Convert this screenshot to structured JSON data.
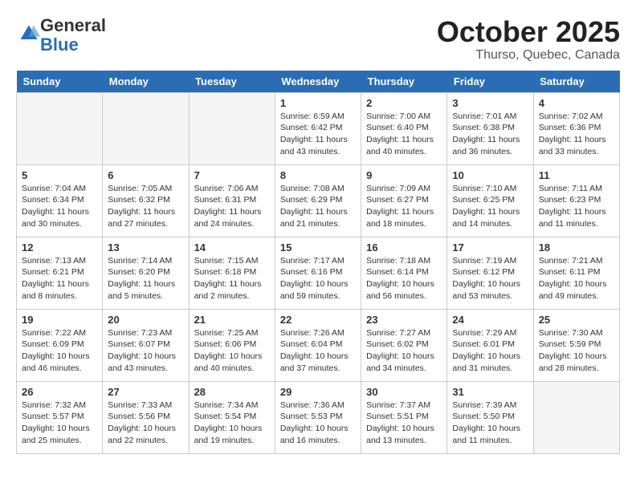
{
  "header": {
    "logo_general": "General",
    "logo_blue": "Blue",
    "month_year": "October 2025",
    "location": "Thurso, Quebec, Canada"
  },
  "days_of_week": [
    "Sunday",
    "Monday",
    "Tuesday",
    "Wednesday",
    "Thursday",
    "Friday",
    "Saturday"
  ],
  "weeks": [
    [
      {
        "day": "",
        "empty": true
      },
      {
        "day": "",
        "empty": true
      },
      {
        "day": "",
        "empty": true
      },
      {
        "day": "1",
        "sunrise": "6:59 AM",
        "sunset": "6:42 PM",
        "daylight": "11 hours and 43 minutes."
      },
      {
        "day": "2",
        "sunrise": "7:00 AM",
        "sunset": "6:40 PM",
        "daylight": "11 hours and 40 minutes."
      },
      {
        "day": "3",
        "sunrise": "7:01 AM",
        "sunset": "6:38 PM",
        "daylight": "11 hours and 36 minutes."
      },
      {
        "day": "4",
        "sunrise": "7:02 AM",
        "sunset": "6:36 PM",
        "daylight": "11 hours and 33 minutes."
      }
    ],
    [
      {
        "day": "5",
        "sunrise": "7:04 AM",
        "sunset": "6:34 PM",
        "daylight": "11 hours and 30 minutes."
      },
      {
        "day": "6",
        "sunrise": "7:05 AM",
        "sunset": "6:32 PM",
        "daylight": "11 hours and 27 minutes."
      },
      {
        "day": "7",
        "sunrise": "7:06 AM",
        "sunset": "6:31 PM",
        "daylight": "11 hours and 24 minutes."
      },
      {
        "day": "8",
        "sunrise": "7:08 AM",
        "sunset": "6:29 PM",
        "daylight": "11 hours and 21 minutes."
      },
      {
        "day": "9",
        "sunrise": "7:09 AM",
        "sunset": "6:27 PM",
        "daylight": "11 hours and 18 minutes."
      },
      {
        "day": "10",
        "sunrise": "7:10 AM",
        "sunset": "6:25 PM",
        "daylight": "11 hours and 14 minutes."
      },
      {
        "day": "11",
        "sunrise": "7:11 AM",
        "sunset": "6:23 PM",
        "daylight": "11 hours and 11 minutes."
      }
    ],
    [
      {
        "day": "12",
        "sunrise": "7:13 AM",
        "sunset": "6:21 PM",
        "daylight": "11 hours and 8 minutes."
      },
      {
        "day": "13",
        "sunrise": "7:14 AM",
        "sunset": "6:20 PM",
        "daylight": "11 hours and 5 minutes."
      },
      {
        "day": "14",
        "sunrise": "7:15 AM",
        "sunset": "6:18 PM",
        "daylight": "11 hours and 2 minutes."
      },
      {
        "day": "15",
        "sunrise": "7:17 AM",
        "sunset": "6:16 PM",
        "daylight": "10 hours and 59 minutes."
      },
      {
        "day": "16",
        "sunrise": "7:18 AM",
        "sunset": "6:14 PM",
        "daylight": "10 hours and 56 minutes."
      },
      {
        "day": "17",
        "sunrise": "7:19 AM",
        "sunset": "6:12 PM",
        "daylight": "10 hours and 53 minutes."
      },
      {
        "day": "18",
        "sunrise": "7:21 AM",
        "sunset": "6:11 PM",
        "daylight": "10 hours and 49 minutes."
      }
    ],
    [
      {
        "day": "19",
        "sunrise": "7:22 AM",
        "sunset": "6:09 PM",
        "daylight": "10 hours and 46 minutes."
      },
      {
        "day": "20",
        "sunrise": "7:23 AM",
        "sunset": "6:07 PM",
        "daylight": "10 hours and 43 minutes."
      },
      {
        "day": "21",
        "sunrise": "7:25 AM",
        "sunset": "6:06 PM",
        "daylight": "10 hours and 40 minutes."
      },
      {
        "day": "22",
        "sunrise": "7:26 AM",
        "sunset": "6:04 PM",
        "daylight": "10 hours and 37 minutes."
      },
      {
        "day": "23",
        "sunrise": "7:27 AM",
        "sunset": "6:02 PM",
        "daylight": "10 hours and 34 minutes."
      },
      {
        "day": "24",
        "sunrise": "7:29 AM",
        "sunset": "6:01 PM",
        "daylight": "10 hours and 31 minutes."
      },
      {
        "day": "25",
        "sunrise": "7:30 AM",
        "sunset": "5:59 PM",
        "daylight": "10 hours and 28 minutes."
      }
    ],
    [
      {
        "day": "26",
        "sunrise": "7:32 AM",
        "sunset": "5:57 PM",
        "daylight": "10 hours and 25 minutes."
      },
      {
        "day": "27",
        "sunrise": "7:33 AM",
        "sunset": "5:56 PM",
        "daylight": "10 hours and 22 minutes."
      },
      {
        "day": "28",
        "sunrise": "7:34 AM",
        "sunset": "5:54 PM",
        "daylight": "10 hours and 19 minutes."
      },
      {
        "day": "29",
        "sunrise": "7:36 AM",
        "sunset": "5:53 PM",
        "daylight": "10 hours and 16 minutes."
      },
      {
        "day": "30",
        "sunrise": "7:37 AM",
        "sunset": "5:51 PM",
        "daylight": "10 hours and 13 minutes."
      },
      {
        "day": "31",
        "sunrise": "7:39 AM",
        "sunset": "5:50 PM",
        "daylight": "10 hours and 11 minutes."
      },
      {
        "day": "",
        "empty": true
      }
    ]
  ]
}
